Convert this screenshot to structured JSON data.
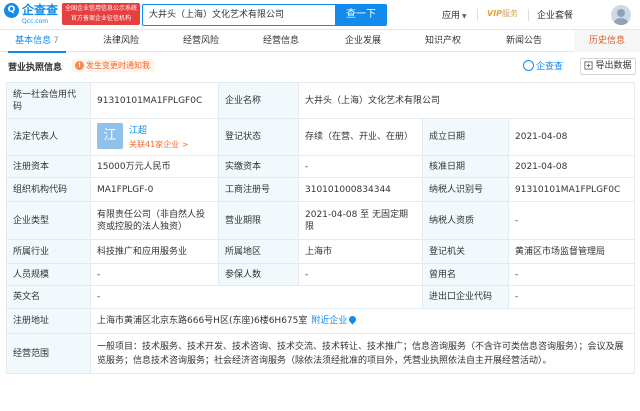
{
  "header": {
    "logo_text": "企查查",
    "logo_sub": "Qcc.com",
    "official_badge": "全国企业信用信息公示系统 官方备案企业征信机构",
    "search_value": "大井头（上海）文化艺术有限公司",
    "search_button": "查一下",
    "apps_label": "应用",
    "vip_label": "VIP",
    "vip_service": "服务",
    "suite_label": "企业套餐"
  },
  "tabs": [
    {
      "label": "基本信息",
      "count": "7"
    },
    {
      "label": "法律风险",
      "count": ""
    },
    {
      "label": "经营风险",
      "count": ""
    },
    {
      "label": "经营信息",
      "count": ""
    },
    {
      "label": "企业发展",
      "count": ""
    },
    {
      "label": "知识产权",
      "count": ""
    },
    {
      "label": "新闻公告",
      "count": ""
    },
    {
      "label": "历史信息",
      "count": ""
    }
  ],
  "section": {
    "title": "营业执照信息",
    "change_notice": "发生变更时通知我",
    "qcc_mark": "企查查",
    "export_label": "导出数据"
  },
  "fields": {
    "credit_code_label": "统一社会信用代码",
    "credit_code": "91310101MA1FPLGF0C",
    "company_name_label": "企业名称",
    "company_name": "大井头（上海）文化艺术有限公司",
    "legal_rep_label": "法定代表人",
    "legal_rep_avatar": "江",
    "legal_rep_name": "江超",
    "legal_rep_related": "关联41家企业 >",
    "status_label": "登记状态",
    "status": "存续（在营、开业、在册）",
    "founded_label": "成立日期",
    "founded": "2021-04-08",
    "reg_capital_label": "注册资本",
    "reg_capital": "15000万元人民币",
    "paid_capital_label": "实缴资本",
    "paid_capital": "-",
    "approved_label": "核准日期",
    "approved": "2021-04-08",
    "org_code_label": "组织机构代码",
    "org_code": "MA1FPLGF-0",
    "biz_reg_no_label": "工商注册号",
    "biz_reg_no": "310101000834344",
    "taxpayer_id_label": "纳税人识别号",
    "taxpayer_id": "91310101MA1FPLGF0C",
    "company_type_label": "企业类型",
    "company_type": "有限责任公司（非自然人投资或控股的法人独资）",
    "biz_term_label": "营业期限",
    "biz_term": "2021-04-08 至 无固定期限",
    "taxpayer_qual_label": "纳税人资质",
    "taxpayer_qual": "-",
    "industry_label": "所属行业",
    "industry": "科技推广和应用服务业",
    "region_label": "所属地区",
    "region": "上海市",
    "reg_authority_label": "登记机关",
    "reg_authority": "黄浦区市场监督管理局",
    "staff_size_label": "人员规模",
    "staff_size": "-",
    "insured_label": "参保人数",
    "insured": "-",
    "former_name_label": "曾用名",
    "former_name": "-",
    "english_name_label": "英文名",
    "english_name": "-",
    "ie_code_label": "进出口企业代码",
    "ie_code": "-",
    "address_label": "注册地址",
    "address": "上海市黄浦区北京东路666号H区(东座)6楼6H675室",
    "nearby_label": "附近企业",
    "scope_label": "经营范围",
    "scope": "一般项目：技术服务、技术开发、技术咨询、技术交流、技术转让、技术推广；信息咨询服务（不含许可类信息咨询服务）；会议及展览服务；信息技术咨询服务；社会经济咨询服务（除依法须经批准的项目外，凭营业执照依法自主开展经营活动）。"
  }
}
